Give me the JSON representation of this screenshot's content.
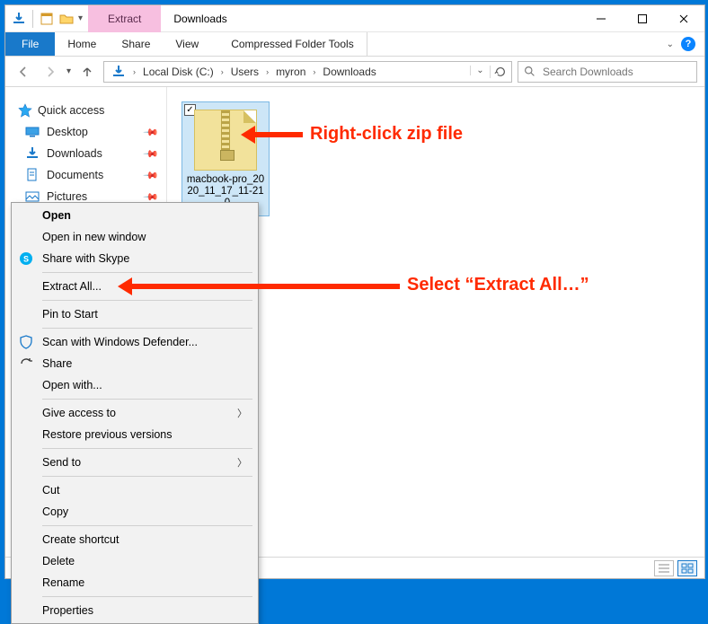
{
  "titlebar": {
    "contextual_tab": "Extract",
    "window_title": "Downloads"
  },
  "ribbon": {
    "file": "File",
    "tabs": [
      "Home",
      "Share",
      "View"
    ],
    "contextual": "Compressed Folder Tools"
  },
  "address": {
    "segments": [
      "Local Disk (C:)",
      "Users",
      "myron",
      "Downloads"
    ],
    "search_placeholder": "Search Downloads"
  },
  "sidebar": {
    "quick_access": "Quick access",
    "items": [
      {
        "label": "Desktop"
      },
      {
        "label": "Downloads"
      },
      {
        "label": "Documents"
      },
      {
        "label": "Pictures"
      }
    ]
  },
  "file": {
    "name": "macbook-pro_2020_11_17_11-21-0"
  },
  "context_menu": {
    "open": "Open",
    "open_new_window": "Open in new window",
    "share_skype": "Share with Skype",
    "extract_all": "Extract All...",
    "pin_start": "Pin to Start",
    "scan_defender": "Scan with Windows Defender...",
    "share": "Share",
    "open_with": "Open with...",
    "give_access": "Give access to",
    "restore_versions": "Restore previous versions",
    "send_to": "Send to",
    "cut": "Cut",
    "copy": "Copy",
    "create_shortcut": "Create shortcut",
    "delete": "Delete",
    "rename": "Rename",
    "properties": "Properties"
  },
  "annotations": {
    "right_click": "Right-click zip file",
    "select_extract": "Select “Extract All…”"
  }
}
